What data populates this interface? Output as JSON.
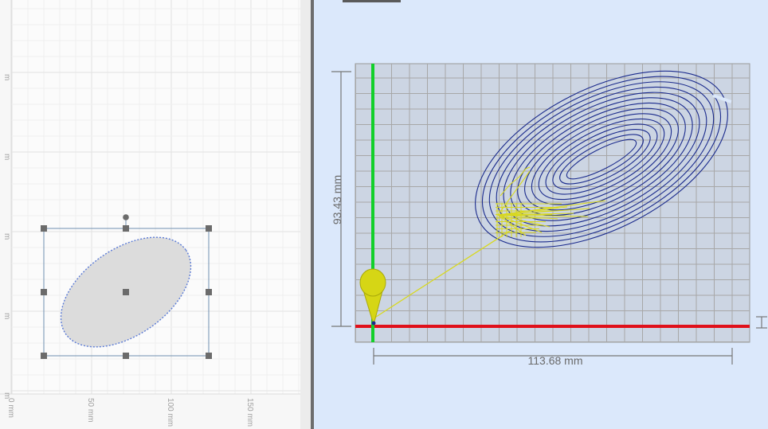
{
  "design": {
    "x_ruler_labels": [
      "0 mm",
      "50 mm",
      "100 mm",
      "150 mm"
    ],
    "y_ruler_labels": [
      "m",
      "m",
      "m",
      "m",
      "m"
    ]
  },
  "preview": {
    "width_label": "113.68 mm",
    "height_label": "93.43 mm",
    "colors": {
      "toolpath": "#1a2a8c",
      "travel": "#d8d820",
      "x_axis": "#e0101a",
      "y_axis": "#12d02a",
      "grid": "#a7a7a7",
      "background": "#dbe8fb"
    }
  }
}
